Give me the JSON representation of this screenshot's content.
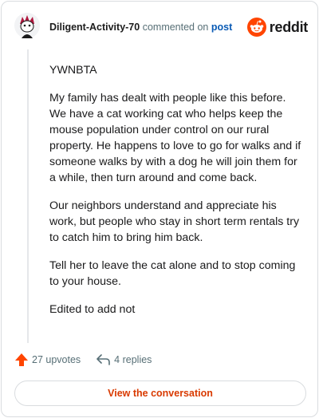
{
  "header": {
    "username": "Diligent-Activity-70",
    "commented_on": "commented on",
    "post_link": "post",
    "brand": "reddit"
  },
  "colors": {
    "reddit_orange": "#ff4500",
    "upvote": "#ff4500",
    "link_blue": "#0a5bb5",
    "view_button_text": "#d93a00"
  },
  "comment": {
    "paragraphs": [
      "YWNBTA",
      "My family has dealt with people like this before. We have a cat working cat who helps keep the mouse population under control on our rural property. He happens to love to go for walks and if someone walks by with a dog he will join them for a while, then turn around and come back.",
      "Our neighbors understand and appreciate his work, but people who stay in short term rentals try to catch him to bring him back.",
      "Tell her to leave the cat alone and to stop coming to your house.",
      "Edited to add not"
    ]
  },
  "footer": {
    "upvotes": "27 upvotes",
    "replies": "4 replies",
    "upvote_icon": "upvote-arrow-icon",
    "reply_icon": "reply-arrow-icon"
  },
  "view_button": {
    "label": "View the conversation"
  }
}
